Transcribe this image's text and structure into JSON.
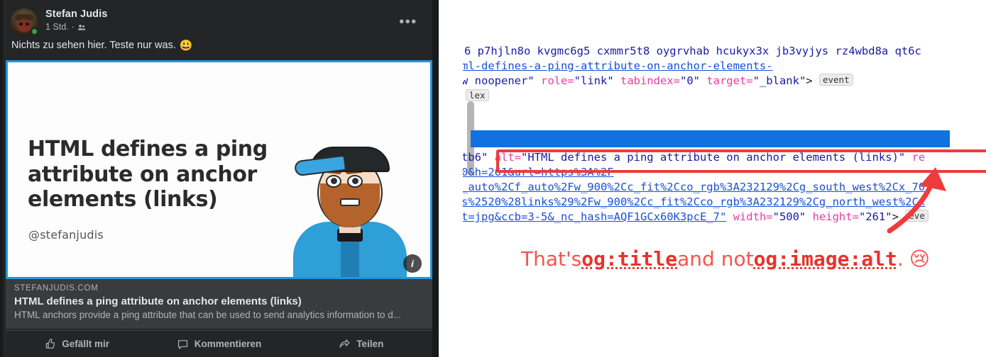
{
  "post": {
    "author": "Stefan Judis",
    "time": "1 Std.",
    "separator": "·",
    "audience_icon": "friends-icon",
    "menu_icon": "ellipsis-icon",
    "body": "Nichts zu sehen hier. Teste nur was.",
    "body_emoji": "😃",
    "online_badge": "online"
  },
  "attachment": {
    "title": "HTML defines a ping attribute on anchor elements (links)",
    "handle": "@stefanjudis",
    "info_icon": "info-icon",
    "border_color": "#2196dd"
  },
  "link_preview": {
    "domain": "STEFANJUDIS.COM",
    "title": "HTML defines a ping attribute on anchor elements (links)",
    "description": "HTML anchors provide a ping attribute that can be used to send analytics information to d..."
  },
  "actions": [
    {
      "label": "Gefällt mir",
      "icon": "thumbs-up-icon"
    },
    {
      "label": "Kommentieren",
      "icon": "comment-bubble-icon"
    },
    {
      "label": "Teilen",
      "icon": "share-arrow-icon"
    }
  ],
  "devtools": {
    "scrollbar": "vertical-scrollbar",
    "selection_color": "#0f72e0",
    "highlight_color": "#ee3b3b",
    "lines": [
      {
        "id": "line-classnames",
        "segments": [
          {
            "text": "6 p7hjln8o kvgmc6g5 cxmmr5t8 oygrvhab hcukyx3x jb3vyjys rz4wbd8a qt6c",
            "kind": "value"
          }
        ]
      },
      {
        "id": "line-href-url",
        "segments": [
          {
            "text": "ml-defines-a-ping-attribute-on-anchor-elements-",
            "kind": "link"
          }
        ]
      },
      {
        "id": "line-attributes",
        "segments": [
          {
            "text": "w noopener\" ",
            "kind": "value"
          },
          {
            "text": "role=",
            "kind": "attr"
          },
          {
            "text": "\"link\" ",
            "kind": "value"
          },
          {
            "text": "tabindex=",
            "kind": "attr"
          },
          {
            "text": "\"0\" ",
            "kind": "value"
          },
          {
            "text": "target=",
            "kind": "attr"
          },
          {
            "text": "\"_blank\"",
            "kind": "value"
          },
          {
            "text": "> ",
            "kind": "plain"
          },
          {
            "text": "event",
            "kind": "badge"
          }
        ]
      },
      {
        "id": "line-flex-badge",
        "segments": [
          {
            "text": "lex",
            "kind": "badge"
          }
        ]
      },
      {
        "id": "line-alt",
        "segments": [
          {
            "text": "tb6\" ",
            "kind": "value"
          },
          {
            "text": "alt=",
            "kind": "attr"
          },
          {
            "text": "\"HTML defines a ping attribute on anchor elements (links)\" ",
            "kind": "value"
          },
          {
            "text": "re",
            "kind": "attr"
          }
        ]
      },
      {
        "id": "line-url-1",
        "segments": [
          {
            "text": "0&h=261&url=https%3A%2F",
            "kind": "link"
          }
        ]
      },
      {
        "id": "line-url-2",
        "segments": [
          {
            "text": "_auto%2Cf_auto%2Fw_900%2Cc_fit%2Cco_rgb%3A232129%2Cg_south_west%2Cx_70",
            "kind": "link"
          }
        ]
      },
      {
        "id": "line-url-3",
        "segments": [
          {
            "text": "s%2520%28links%29%2Fw_900%2Cc_fit%2Cco_rgb%3A232129%2Cg_north_west%2Cx",
            "kind": "link"
          }
        ]
      },
      {
        "id": "line-url-4",
        "segments": [
          {
            "text": "t=jpg&ccb=3-5&_nc_hash=AQF1GCx60K3pcE_7\"",
            "kind": "link"
          },
          {
            "text": " width=",
            "kind": "attr"
          },
          {
            "text": "\"500\" ",
            "kind": "value"
          },
          {
            "text": "height=",
            "kind": "attr"
          },
          {
            "text": "\"261\"",
            "kind": "value"
          },
          {
            "text": "> ",
            "kind": "plain"
          },
          {
            "text": "eve",
            "kind": "badge"
          }
        ]
      }
    ]
  },
  "caption": {
    "part1": "That's ",
    "code1": "og:title",
    "part2": " and not ",
    "code2": "og:image:alt",
    "part3": ".",
    "emoji": "😢",
    "color": "#f4544f"
  }
}
